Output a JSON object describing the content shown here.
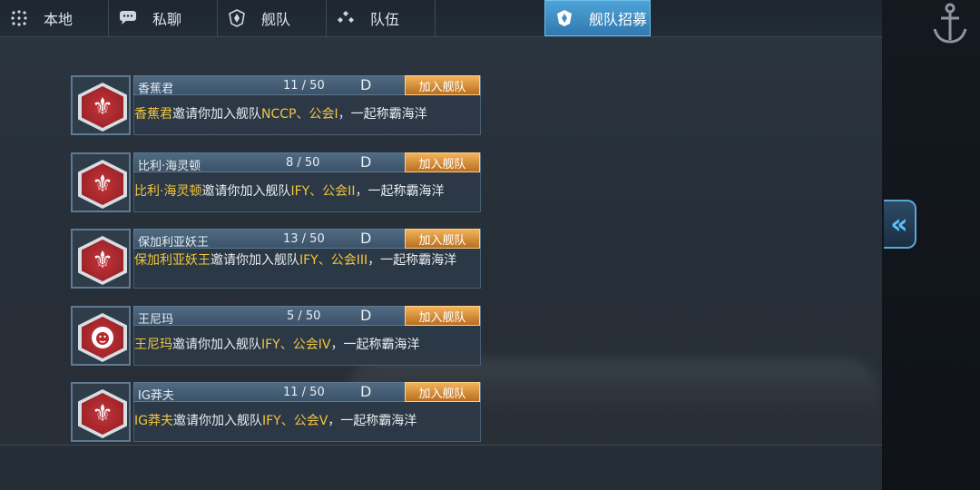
{
  "tabs": [
    {
      "label": "本地",
      "icon": "globe-icon"
    },
    {
      "label": "私聊",
      "icon": "chat-bubble-icon"
    },
    {
      "label": "舰队",
      "icon": "fleet-emblem-icon"
    },
    {
      "label": "队伍",
      "icon": "team-dots-icon"
    },
    {
      "label": "舰队招募",
      "icon": "fleet-emblem-icon",
      "active": true
    }
  ],
  "recruits": [
    {
      "name": "香蕉君",
      "count": "11 / 50",
      "grade": "D",
      "join": "加入舰队",
      "msg_name": "香蕉君",
      "msg_mid": "邀请你加入舰队",
      "msg_fleet": "NCCP、公会I",
      "msg_end": "，一起称霸海洋",
      "emblem": "fleur-de-lis-icon"
    },
    {
      "name": "比利·海灵顿",
      "count": "8 / 50",
      "grade": "D",
      "join": "加入舰队",
      "msg_name": "比利·海灵顿",
      "msg_mid": "邀请你加入舰队",
      "msg_fleet": "IFY、公会II",
      "msg_end": "，一起称霸海洋",
      "emblem": "fleur-de-lis-icon"
    },
    {
      "name": "保加利亚妖王",
      "count": "13 / 50",
      "grade": "D",
      "join": "加入舰队",
      "msg_name": "保加利亚妖王",
      "msg_mid": "邀请你加入舰队",
      "msg_fleet": "IFY、公会III",
      "msg_end": "，一起称霸海洋",
      "emblem": "fleur-de-lis-icon"
    },
    {
      "name": "王尼玛",
      "count": "5 / 50",
      "grade": "D",
      "join": "加入舰队",
      "msg_name": "王尼玛",
      "msg_mid": "邀请你加入舰队",
      "msg_fleet": "IFY、公会IV",
      "msg_end": "，一起称霸海洋",
      "emblem": "lion-head-icon"
    },
    {
      "name": "IG莽夫",
      "count": "11 / 50",
      "grade": "D",
      "join": "加入舰队",
      "msg_name": "IG莽夫",
      "msg_mid": "邀请你加入舰队",
      "msg_fleet": "IFY、公会V",
      "msg_end": "，一起称霸海洋",
      "emblem": "fleur-de-lis-icon"
    }
  ],
  "colors": {
    "highlight": "#f3c63f",
    "join_button": "#e0953d",
    "active_tab": "#3f8fc6",
    "emblem_red": "#b8282e"
  },
  "side": {
    "collapse_icon": "double-chevron-left-icon",
    "anchor_icon": "anchor-icon"
  }
}
